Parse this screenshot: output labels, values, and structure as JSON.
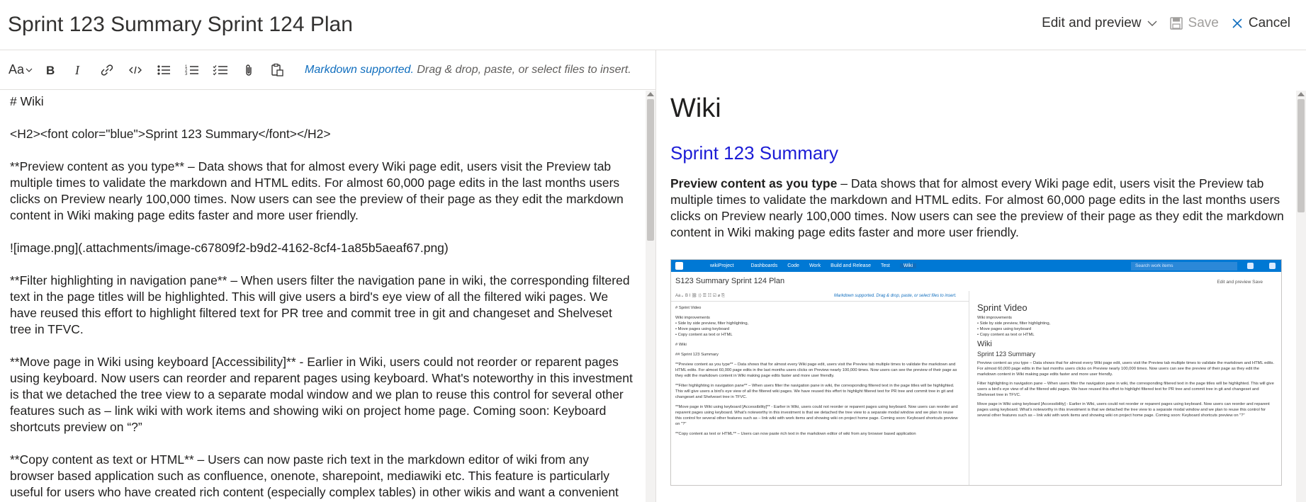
{
  "header": {
    "title": "Sprint 123 Summary Sprint 124 Plan",
    "mode_label": "Edit and preview",
    "save_label": "Save",
    "cancel_label": "Cancel"
  },
  "toolbar": {
    "font_size_label": "Aa",
    "hint_link": "Markdown supported.",
    "hint_text": " Drag & drop, paste, or select files to insert.",
    "icons": [
      "header-size-icon",
      "bold-icon",
      "italic-icon",
      "link-icon",
      "code-icon",
      "bulleted-list-icon",
      "numbered-list-icon",
      "checklist-icon",
      "attachment-icon",
      "paste-icon"
    ]
  },
  "editor": {
    "lines": [
      "# Wiki",
      "<H2><font color=\"blue\">Sprint 123 Summary</font></H2>",
      "**Preview content as you type** – Data shows that for almost every Wiki page edit, users visit the Preview tab multiple times to validate the markdown and HTML edits. For almost 60,000 page edits in the last months users clicks on Preview nearly 100,000 times. Now users can see the preview of their page as they edit the markdown content in Wiki making page edits faster and more user friendly.",
      "![image.png](.attachments/image-c67809f2-b9d2-4162-8cf4-1a85b5aeaf67.png)",
      "**Filter highlighting in navigation pane** – When users filter the navigation pane in wiki, the corresponding filtered text in the page titles will be highlighted. This will give users a bird's eye view of all the filtered wiki pages. We have reused this effort to highlight filtered text for PR tree and commit tree in git and changeset and Shelveset tree in TFVC.",
      "**Move page in Wiki using keyboard [Accessibility]** - Earlier in Wiki, users could not reorder or reparent pages using keyboard. Now users can reorder and reparent pages using keyboard. What's noteworthy in this investment is that we detached the tree view to a separate modal window and we plan to reuse this control for several other features such as – link wiki with work items and showing wiki on project home page. Coming soon: Keyboard shortcuts preview on “?”",
      "**Copy content as text or HTML** – Users can now paste rich text in the markdown editor of wiki from any browser based application such as confluence, onenote, sharepoint, mediawiki etc. This feature is particularly useful for users who have created rich content (especially complex tables) in other wikis and want a convenient was to simply copy"
    ]
  },
  "preview": {
    "h1": "Wiki",
    "h2": "Sprint 123 Summary",
    "h2_color": "#1c1cd6",
    "para_bold": "Preview content as you type",
    "para_text": " – Data shows that for almost every Wiki page edit, users visit the Preview tab multiple times to validate the markdown and HTML edits. For almost 60,000 page edits in the last months users clicks on Preview nearly 100,000 times. Now users can see the preview of their page as they edit the markdown content in Wiki making page edits faster and more user friendly.",
    "image": {
      "nav_project": "wikiProject",
      "nav_tabs": [
        "Dashboards",
        "Code",
        "Work",
        "Build and Release",
        "Test",
        "Wiki"
      ],
      "search_placeholder": "Search work items",
      "title": "S123 Summary Sprint 124 Plan",
      "right_actions": "Edit and preview    Save",
      "toolbar_hint": "Markdown supported. Drag & drop, paste, or select files to insert.",
      "left_lines": [
        "# Sprint Video",
        "Wiki improvements",
        "•   Side by side preview, filter highlighting,",
        "•   Move pages using keyboard",
        "•   Copy content as text or HTML",
        "# Wiki",
        "## Sprint 123 Summary",
        "**Preview content as you type** – Data shows that for almost every Wiki page edit, users visit the Preview tab multiple times to validate the markdown and HTML edits. For almost 60,000 page edits in the last months users clicks on Preview nearly 100,000 times. Now users can see the preview of their page as they edit the markdown content in Wiki making page edits faster and more user friendly.",
        "**Filter highlighting in navigation pane** – When users filter the navigation pane in wiki, the corresponding filtered text in the page titles will be highlighted. This will give users a bird's eye view of all the filtered wiki pages. We have reused this effort to highlight filtered text for PR tree and commit tree in git and changeset and Shelveset tree in TFVC.",
        "**Move page in Wiki using keyboard [Accessibility]** - Earlier in Wiki, users could not reorder or reparent pages using keyboard. Now users can reorder and reparent pages using keyboard. What's noteworthy in this investment is that we detached the tree view to a separate modal window and we plan to reuse this control for several other features such as – link wiki with work items and showing wiki on project home page. Coming soon: Keyboard shortcuts preview on \"?\"",
        "**Copy content as text or HTML** – Users can now paste rich text in the markdown editor of wiki from any browser based application"
      ],
      "right_h1": "Sprint Video",
      "right_lines": [
        "Wiki improvements",
        "• Side by side preview, filter highlighting,",
        "• Move pages using keyboard",
        "• Copy content as text or HTML"
      ],
      "right_h1b": "Wiki",
      "right_h2": "Sprint 123 Summary",
      "right_paras": [
        "Preview content as you type – Data shows that for almost every Wiki page edit, users visit the Preview tab multiple times to validate the markdown and HTML edits. For almost 60,000 page edits in the last months users clicks on Preview nearly 100,000 times. Now users can see the preview of their page as they edit the markdown content in Wiki making page edits faster and more user friendly.",
        "Filter highlighting in navigation pane – When users filter the navigation pane in wiki, the corresponding filtered text in the page titles will be highlighted. This will give users a bird's eye view of all the filtered wiki pages. We have reused this effort to highlight filtered text for PR tree and commit tree in git and changeset and Shelveset tree in TFVC.",
        "Move page in Wiki using keyboard [Accessibility] - Earlier in Wiki, users could not reorder or reparent pages using keyboard. Now users can reorder and reparent pages using keyboard. What's noteworthy in this investment is that we detached the tree view to a separate modal window and we plan to reuse this control for several other features such as – link wiki with work items and showing wiki on project home page. Coming soon: Keyboard shortcuts preview on \"?\""
      ]
    }
  }
}
